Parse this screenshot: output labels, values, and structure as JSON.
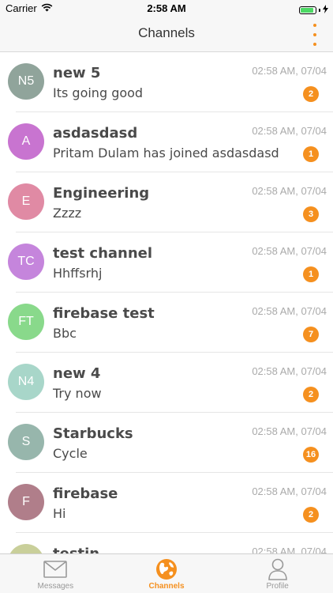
{
  "status_bar": {
    "carrier": "Carrier",
    "time": "2:58 AM",
    "battery_level": 0.9,
    "battery_color": "#4cd964"
  },
  "nav": {
    "title": "Channels",
    "menu_icon": "vertical-dots-icon",
    "accent_color": "#f5901f"
  },
  "channels": [
    {
      "initials": "N5",
      "title": "new 5",
      "message": "Its going good",
      "time": "02:58 AM, 07/04",
      "unread": "2",
      "avatar_color": "#90a49b"
    },
    {
      "initials": "A",
      "title": "asdasdasd",
      "message": "Pritam Dulam has joined asdasdasd",
      "time": "02:58 AM, 07/04",
      "unread": "1",
      "avatar_color": "#c874d0"
    },
    {
      "initials": "E",
      "title": "Engineering",
      "message": "Zzzz",
      "time": "02:58 AM, 07/04",
      "unread": "3",
      "avatar_color": "#e08aa4"
    },
    {
      "initials": "TC",
      "title": "test channel",
      "message": "Hhffsrhj",
      "time": "02:58 AM, 07/04",
      "unread": "1",
      "avatar_color": "#c585dc"
    },
    {
      "initials": "FT",
      "title": "firebase test",
      "message": "Bbc",
      "time": "02:58 AM, 07/04",
      "unread": "7",
      "avatar_color": "#89d98b"
    },
    {
      "initials": "N4",
      "title": "new 4",
      "message": "Try now",
      "time": "02:58 AM, 07/04",
      "unread": "2",
      "avatar_color": "#a8d6c9"
    },
    {
      "initials": "S",
      "title": "Starbucks",
      "message": "Cycle",
      "time": "02:58 AM, 07/04",
      "unread": "16",
      "avatar_color": "#97b6ac"
    },
    {
      "initials": "F",
      "title": "firebase",
      "message": "Hi",
      "time": "02:58 AM, 07/04",
      "unread": "2",
      "avatar_color": "#b07e8a"
    },
    {
      "initials": "T",
      "title": "testin",
      "message": "",
      "time": "02:58 AM, 07/04",
      "unread": "",
      "avatar_color": "#c9cf9a"
    }
  ],
  "tabs": [
    {
      "label": "Messages",
      "icon": "envelope-icon",
      "active": false
    },
    {
      "label": "Channels",
      "icon": "globe-icon",
      "active": true
    },
    {
      "label": "Profile",
      "icon": "person-icon",
      "active": false
    }
  ]
}
